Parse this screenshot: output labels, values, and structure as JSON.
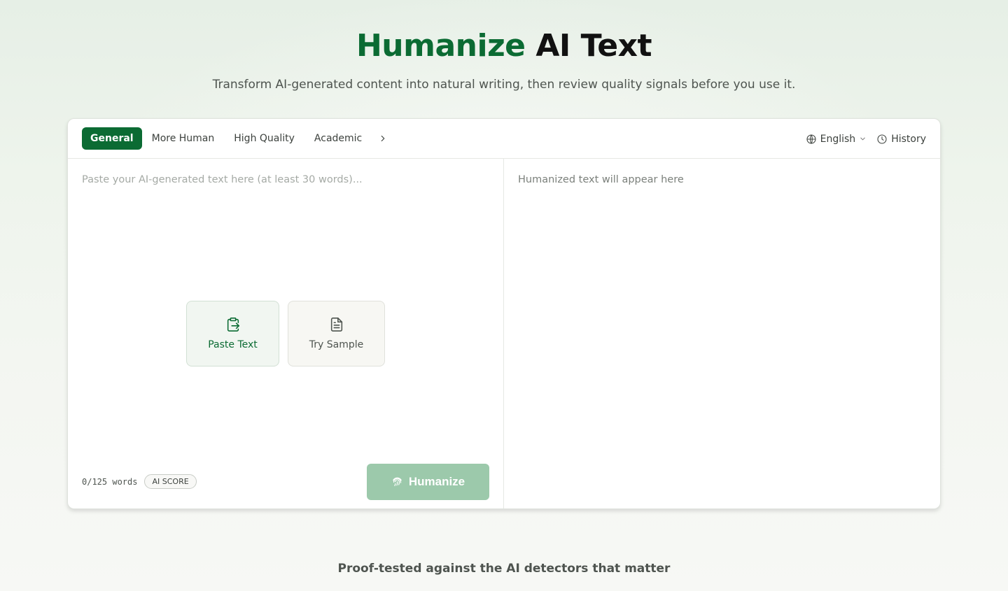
{
  "hero": {
    "title_accent": "Humanize",
    "title_rest": "AI Text",
    "subtitle": "Transform AI-generated content into natural writing, then review quality signals before you use it."
  },
  "tabs": [
    {
      "label": "General",
      "active": true
    },
    {
      "label": "More Human",
      "active": false
    },
    {
      "label": "High Quality",
      "active": false
    },
    {
      "label": "Academic",
      "active": false
    }
  ],
  "toolbar": {
    "language": "English",
    "history": "History"
  },
  "input": {
    "placeholder": "Paste your AI-generated text here (at least 30 words)...",
    "value": "",
    "paste_label": "Paste Text",
    "sample_label": "Try Sample",
    "word_count": "0/125 words",
    "ai_score_label": "AI SCORE",
    "humanize_label": "Humanize"
  },
  "output": {
    "placeholder": "Humanized text will appear here"
  },
  "footer": {
    "proof_text": "Proof-tested against the AI detectors that matter"
  },
  "colors": {
    "brand": "#0b6b33",
    "humanize_disabled": "#9cc9ab"
  }
}
